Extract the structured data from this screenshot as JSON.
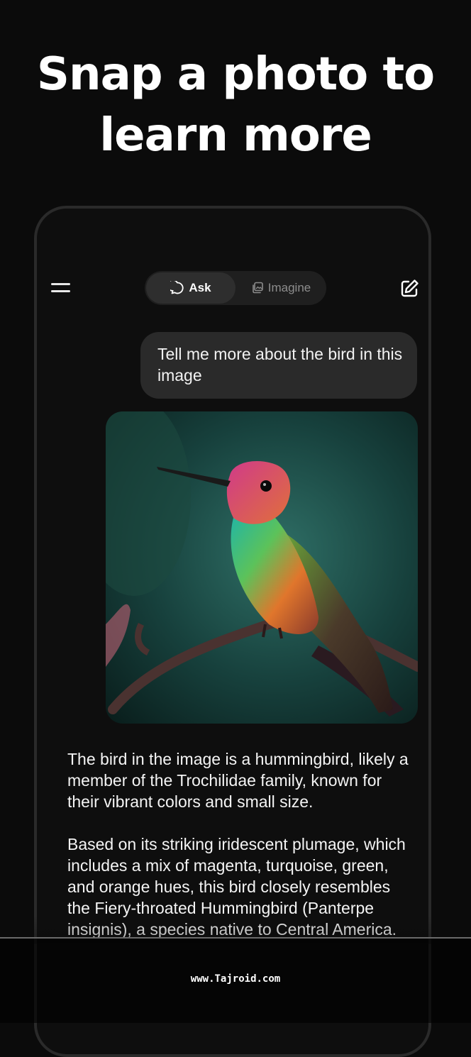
{
  "headline": {
    "line1": "Snap a photo to",
    "line2": "learn more"
  },
  "header": {
    "menu_icon": "hamburger-menu-icon",
    "tabs": [
      {
        "label": "Ask",
        "icon": "chat-bubble-icon",
        "selected": true
      },
      {
        "label": "Imagine",
        "icon": "image-stack-icon",
        "selected": false
      }
    ],
    "edit_icon": "new-chat-edit-icon"
  },
  "chat": {
    "user_message": "Tell me more about the bird in this image",
    "image_subject": "hummingbird-photo",
    "reply_paragraphs": [
      "The bird in the image is a hummingbird, likely a member of the Trochilidae family, known for their vibrant colors and small size.",
      "Based on its striking iridescent plumage, which includes a mix of magenta, turquoise, green, and orange hues, this bird closely resembles the Fiery-throated Hummingbird (Panterpe insignis), a species native to Central America."
    ]
  },
  "watermark": "www.Tajroid.com",
  "colors": {
    "background": "#0b0b0b",
    "bubble": "#2a2a2a",
    "segment": "#1f1f1f",
    "segment_active": "#2e2e2e"
  }
}
